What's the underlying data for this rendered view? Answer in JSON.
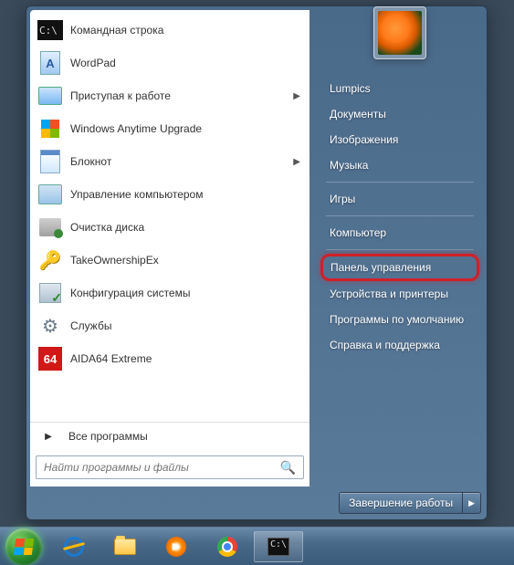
{
  "programs": [
    {
      "label": "Командная строка",
      "icon": "cmd",
      "submenu": false
    },
    {
      "label": "WordPad",
      "icon": "wordpad",
      "submenu": false
    },
    {
      "label": "Приступая к работе",
      "icon": "getting",
      "submenu": true
    },
    {
      "label": "Windows Anytime Upgrade",
      "icon": "anytime",
      "submenu": false
    },
    {
      "label": "Блокнот",
      "icon": "notepad",
      "submenu": true
    },
    {
      "label": "Управление компьютером",
      "icon": "mgmt",
      "submenu": false
    },
    {
      "label": "Очистка диска",
      "icon": "disk",
      "submenu": false
    },
    {
      "label": "TakeOwnershipEx",
      "icon": "own",
      "submenu": false
    },
    {
      "label": "Конфигурация системы",
      "icon": "msconfig",
      "submenu": false
    },
    {
      "label": "Службы",
      "icon": "services",
      "submenu": false
    },
    {
      "label": "AIDA64 Extreme",
      "icon": "aida",
      "submenu": false
    }
  ],
  "all_programs": "Все программы",
  "search": {
    "placeholder": "Найти программы и файлы"
  },
  "right_items": [
    {
      "label": "Lumpics",
      "sep_after": false
    },
    {
      "label": "Документы",
      "sep_after": false
    },
    {
      "label": "Изображения",
      "sep_after": false
    },
    {
      "label": "Музыка",
      "sep_after": true
    },
    {
      "label": "Игры",
      "sep_after": true
    },
    {
      "label": "Компьютер",
      "sep_after": true
    },
    {
      "label": "Панель управления",
      "sep_after": false,
      "highlight": true
    },
    {
      "label": "Устройства и принтеры",
      "sep_after": false
    },
    {
      "label": "Программы по умолчанию",
      "sep_after": false
    },
    {
      "label": "Справка и поддержка",
      "sep_after": false
    }
  ],
  "shutdown": {
    "label": "Завершение работы"
  },
  "taskbar": [
    {
      "name": "internet-explorer",
      "active": false
    },
    {
      "name": "file-explorer",
      "active": false
    },
    {
      "name": "media-player",
      "active": false
    },
    {
      "name": "chrome",
      "active": false
    },
    {
      "name": "command-prompt",
      "active": true
    }
  ],
  "icons": {
    "aida_text": "64",
    "cmd_text": "C:\\",
    "own_glyph": "🔑",
    "services_glyph": "⚙",
    "wmp_glyph": "▶"
  }
}
